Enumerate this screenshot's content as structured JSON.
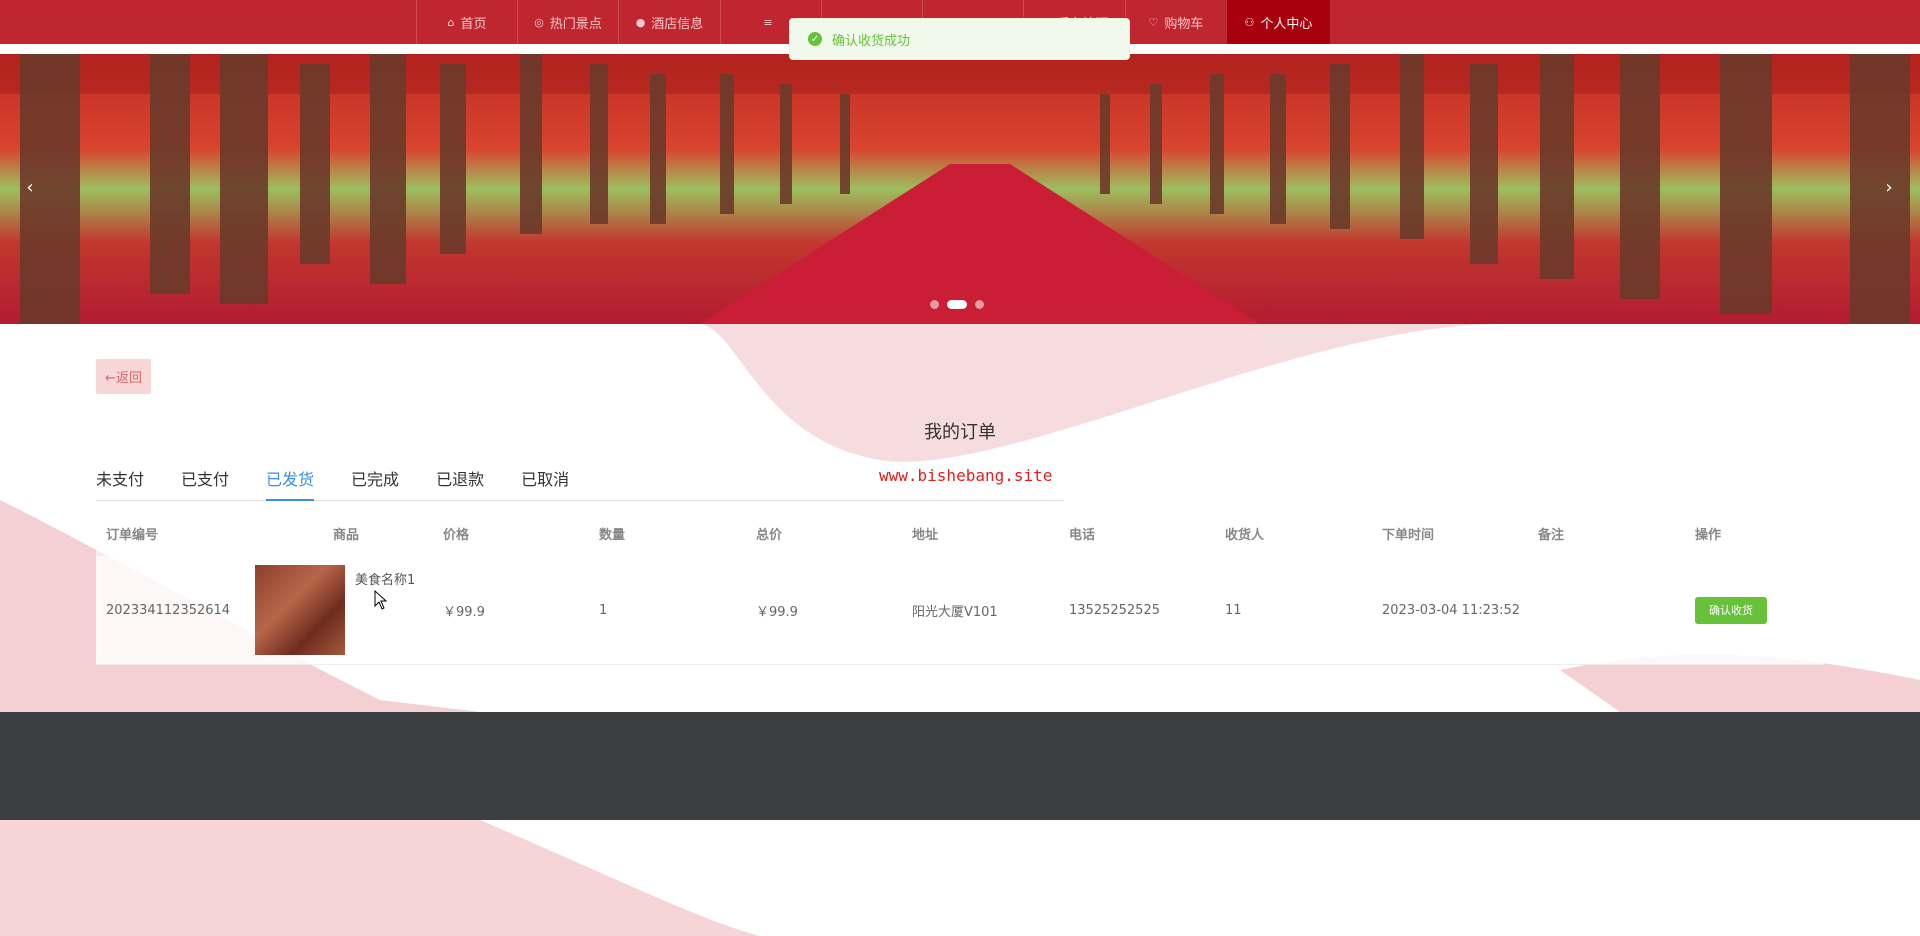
{
  "nav": {
    "items": [
      {
        "label": "首页",
        "icon": "home-icon"
      },
      {
        "label": "热门景点",
        "icon": "location-icon"
      },
      {
        "label": "酒店信息",
        "icon": "info-icon"
      },
      {
        "label": "",
        "icon": "menu-icon"
      },
      {
        "label": "",
        "icon": "menu-icon"
      },
      {
        "label": "",
        "icon": "menu-icon"
      },
      {
        "label": "后台管理",
        "icon": "admin-icon"
      },
      {
        "label": "购物车",
        "icon": "cart-icon"
      },
      {
        "label": "个人中心",
        "icon": "user-icon"
      }
    ],
    "active_index": 8
  },
  "toast": {
    "message": "确认收货成功",
    "icon": "success-icon"
  },
  "banner": {
    "dots": 3,
    "active_dot": 1,
    "prev": "‹",
    "next": "›"
  },
  "content": {
    "back_label": "←返回",
    "title": "我的订单",
    "watermark": "www.bishebang.site",
    "tabs": [
      "未支付",
      "已支付",
      "已发货",
      "已完成",
      "已退款",
      "已取消"
    ],
    "active_tab": 2
  },
  "table": {
    "columns": [
      "订单编号",
      "商品",
      "价格",
      "数量",
      "总价",
      "地址",
      "电话",
      "收货人",
      "下单时间",
      "备注",
      "操作"
    ],
    "rows": [
      {
        "order_no": "202334112352614",
        "goods_name": "美食名称1",
        "price": "￥99.9",
        "quantity": "1",
        "total": "￥99.9",
        "address": "阳光大厦V101",
        "phone": "13525252525",
        "receiver": "11",
        "order_time": "2023-03-04 11:23:52",
        "remark": "",
        "action": "确认收货"
      }
    ]
  },
  "colors": {
    "nav": "#c0262f",
    "nav_active": "#a8000c",
    "accent": "#3a8ee6",
    "success": "#67c23a",
    "footer": "#3d3e40"
  }
}
